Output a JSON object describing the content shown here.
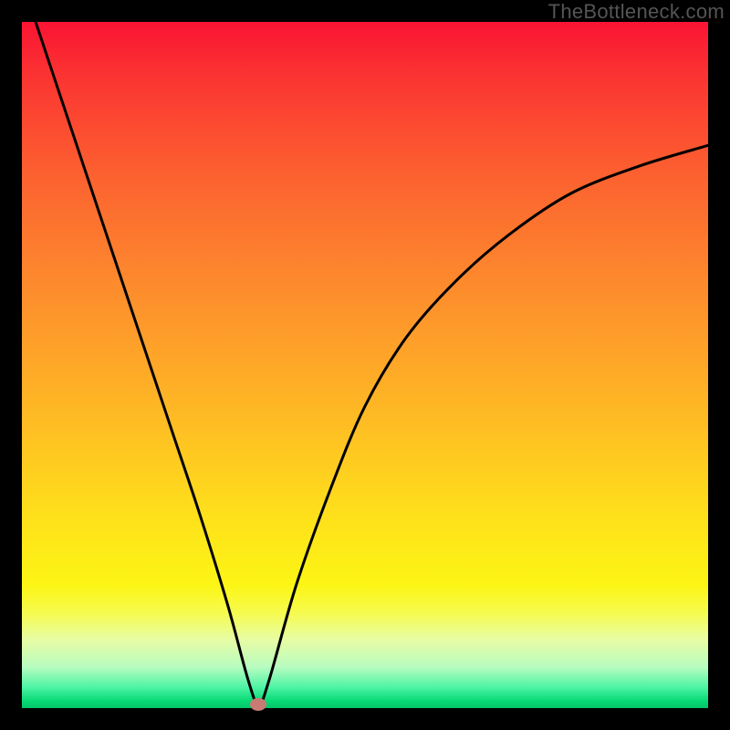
{
  "watermark_text": "TheBottleneck.com",
  "chart_data": {
    "type": "line",
    "title": "",
    "xlabel": "",
    "ylabel": "",
    "xlim": [
      0,
      100
    ],
    "ylim": [
      0,
      100
    ],
    "grid": false,
    "legend": false,
    "background_gradient": [
      "#fa1433",
      "#feb425",
      "#fcf514",
      "#04c46a"
    ],
    "series": [
      {
        "name": "bottleneck-curve",
        "color": "#000000",
        "x": [
          2,
          6,
          10,
          14,
          18,
          22,
          26,
          30,
          33,
          34.5,
          36,
          40,
          45,
          50,
          56,
          63,
          71,
          80,
          90,
          100
        ],
        "values": [
          100,
          88,
          76,
          64,
          52,
          40,
          28,
          15,
          4,
          0.5,
          4,
          18,
          32,
          44,
          54,
          62,
          69,
          75,
          79,
          82
        ]
      }
    ],
    "marker": {
      "name": "optimal-point",
      "x": 34.5,
      "y": 0.5,
      "color": "#c77b72"
    }
  }
}
